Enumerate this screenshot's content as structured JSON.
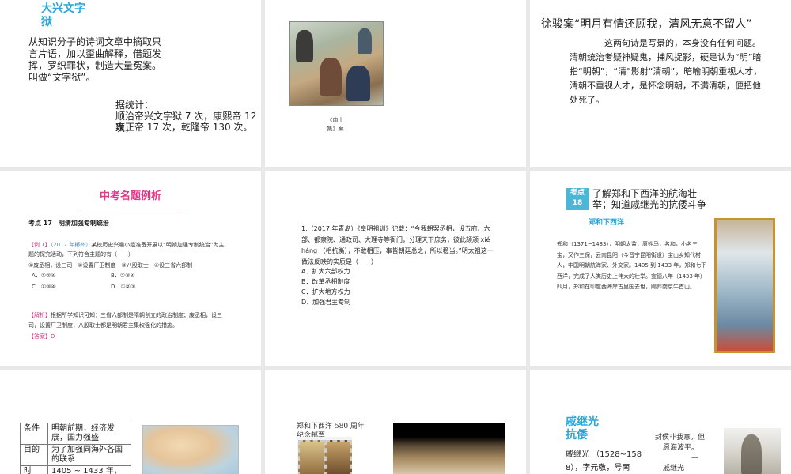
{
  "slide1": {
    "title": "大兴文字狱",
    "para": "从知识分子的诗词文章中摘取只言片语，加以歪曲解释，借题发挥，罗织罪状，制造大量冤案。叫做“文字狱”。",
    "stats_label": "据统计：",
    "stats_line1": "顺治帝兴文字狱 7 次，康熙帝 12 次，",
    "stats_line2": "雍正帝 17 次，乾隆帝 130 次。"
  },
  "slide2": {
    "caption_line1": "《南山",
    "caption_line2": "集》案"
  },
  "slide3": {
    "title": "徐骏案“明月有情还顾我，清风无意不留人”",
    "para": "这两句诗是写景的，本身没有任何问题。清朝统治者疑神疑鬼，捕风捉影，硬是认为“明”暗指“明朝”，“清”影射“清朝”，暗喻明朝重视人才，清朝不重视人才，是怀念明朝，不满清朝，便把他处死了。"
  },
  "slide4": {
    "header": "中考名题例析",
    "topic": "考点 17　明清加强专制统治",
    "example_tag": "【例 1】",
    "example_src": "（2017 年郴州）",
    "example_text": "某校历史兴趣小组准备开展以“明朝加强专制统治”为主题的探究活动，下列符合主题的有（　　）",
    "options_line": "①废丞相，设三司　②设置厂卫制度　③八股取士　④设三省六部制",
    "opt_a": "A．①②④",
    "opt_b": "B．②③④",
    "opt_c": "C．①③④",
    "opt_d": "D．①②③",
    "analysis_tag": "【解析】",
    "analysis_text": "根据所学知识可知：三省六部制是隋朝创立的政治制度；废丞相，设三司，设置厂卫制度，八股取士都是明朝君主集权强化的措施。",
    "answer_tag": "【答案】",
    "answer_val": "D"
  },
  "slide5": {
    "question": "1.（2017 年青岛）《皇明祖训》记载：“今我朝罢丞相，设五府、六部、都察院、通政司、大理寺等衙门，分理天下庶务，彼此颉颃 xié háng （相抗衡），不敢相压，事皆朝廷总之，所以稳当。”明太祖这一做法反映的实质是（　　）",
    "opt_a": "A．扩大六部权力",
    "opt_b": "B．改革丞相制度",
    "opt_c": "C．扩大地方权力",
    "opt_d": "D．加强君主专制"
  },
  "slide6": {
    "kd_label": "考点 18",
    "title": "了解郑和下西洋的航海壮举；知道戚继光的抗倭斗争",
    "sub": "郑和下西洋",
    "para": "郑和（1371~1433），明朝太监，原姓马，名和，小名三宝，又作三保，云南昆阳（今晋宁昆阳街道）宝山乡知代村人，中国明朝航海家、外交家。1405 到 1433 年，郑和七下西洋，完成了人类历史上伟大的壮举。宣德八年（1433 年）四月，郑和在印度西海岸古里国去世，赐葬南京牛首山。"
  },
  "slide7": {
    "rows": [
      {
        "k": "条件",
        "v": "明朝前期，经济发展，国力强盛"
      },
      {
        "k": "目的",
        "v": "为了加强同海外各国的联系"
      },
      {
        "k": "时间、",
        "v": "1405 ~ 1433 年，刘"
      }
    ]
  },
  "slide8": {
    "caption_line1": "郑和下西洋 580 周年",
    "caption_line2": "纪念邮票"
  },
  "slide9": {
    "title_line1": "戚继光",
    "title_line2": "抗倭",
    "bio_line1": "戚继光 （1528~158",
    "bio_line2": "8），字元敬，号南",
    "poem_line1": "封侯非我意，但",
    "poem_line2": "愿海波平。",
    "dash": "—",
    "poem_author": "戚继光"
  }
}
